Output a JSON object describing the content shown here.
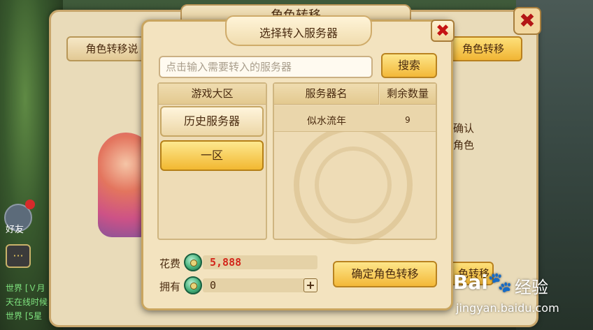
{
  "back_panel": {
    "title": "角色转移",
    "left_button": "角色转移说",
    "right_button": "角色转移",
    "info_line1": "确认",
    "info_line2": "角色",
    "bottom_button": "色转移"
  },
  "hud": {
    "friend_label": "好友",
    "chat_icon": "···",
    "world_1": "世界 [Ｖ月",
    "world_2": "天在线时候",
    "world_3": "世界 [5星"
  },
  "dialog": {
    "title": "选择转入服务器",
    "close": "✖",
    "search": {
      "placeholder": "点击输入需要转入的服务器",
      "button": "搜索"
    },
    "zones": {
      "header": "游戏大区",
      "items": [
        "历史服务器",
        "一区"
      ]
    },
    "servers": {
      "header_name": "服务器名",
      "header_count": "剩余数量",
      "rows": [
        {
          "name": "似水流年",
          "count": "9"
        }
      ]
    },
    "cost_label": "花费",
    "cost_value": "5,888",
    "own_label": "拥有",
    "own_value": "0",
    "plus": "+",
    "confirm": "确定角色转移"
  },
  "watermark": {
    "logo": "Bai🐾",
    "jingyan": "经验",
    "url": "jingyan.baidu.com"
  }
}
